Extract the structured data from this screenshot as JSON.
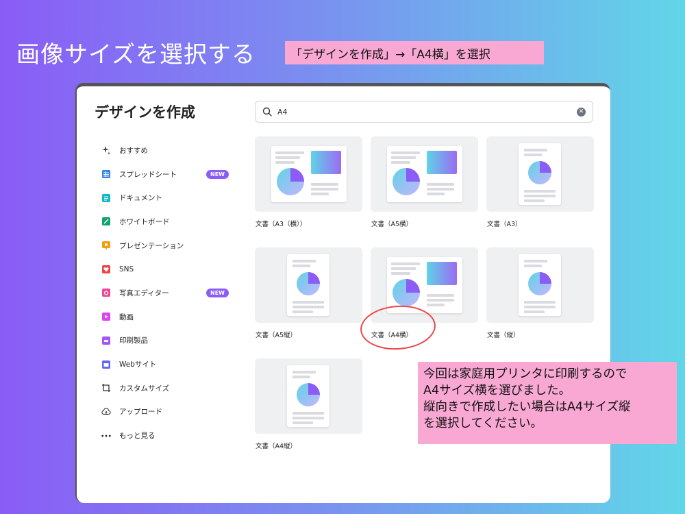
{
  "slide": {
    "title": "画像サイズを選択する",
    "instruction": "「デザインを作成」→「A4横」を選択"
  },
  "dialog": {
    "title": "デザインを作成",
    "search": {
      "value": "A4",
      "placeholder": ""
    },
    "sidebar": {
      "items": [
        {
          "label": "おすすめ",
          "icon": "sparkle-icon",
          "badge": ""
        },
        {
          "label": "スプレッドシート",
          "icon": "spreadsheet-icon",
          "badge": "NEW"
        },
        {
          "label": "ドキュメント",
          "icon": "document-icon",
          "badge": ""
        },
        {
          "label": "ホワイトボード",
          "icon": "whiteboard-icon",
          "badge": ""
        },
        {
          "label": "プレゼンテーション",
          "icon": "presentation-icon",
          "badge": ""
        },
        {
          "label": "SNS",
          "icon": "heart-icon",
          "badge": ""
        },
        {
          "label": "写真エディター",
          "icon": "camera-icon",
          "badge": "NEW"
        },
        {
          "label": "動画",
          "icon": "video-icon",
          "badge": ""
        },
        {
          "label": "印刷製品",
          "icon": "printer-icon",
          "badge": ""
        },
        {
          "label": "Webサイト",
          "icon": "website-icon",
          "badge": ""
        },
        {
          "label": "カスタムサイズ",
          "icon": "custom-size-icon",
          "badge": ""
        },
        {
          "label": "アップロード",
          "icon": "upload-cloud-icon",
          "badge": ""
        },
        {
          "label": "もっと見る",
          "icon": "more-icon",
          "badge": ""
        }
      ]
    },
    "templates": [
      {
        "label": "文書（A3（横））",
        "orientation": "landscape"
      },
      {
        "label": "文書（A5横）",
        "orientation": "landscape"
      },
      {
        "label": "文書（A3）",
        "orientation": "portrait"
      },
      {
        "label": "文書（A5縦）",
        "orientation": "portrait"
      },
      {
        "label": "文書（A4横）",
        "orientation": "landscape"
      },
      {
        "label": "文書（縦）",
        "orientation": "portrait"
      },
      {
        "label": "文書（A4縦）",
        "orientation": "portrait"
      }
    ]
  },
  "callout": {
    "lines": [
      "今回は家庭用プリンタに印刷するので",
      "A4サイズ横を選びました。",
      "縦向きで作成したい場合はA4サイズ縦",
      "を選択してください。"
    ]
  },
  "colors": {
    "accent_purple": "#8b5cf6",
    "highlight_pink": "#f9a8d4",
    "annotation_red": "#ef4444"
  }
}
